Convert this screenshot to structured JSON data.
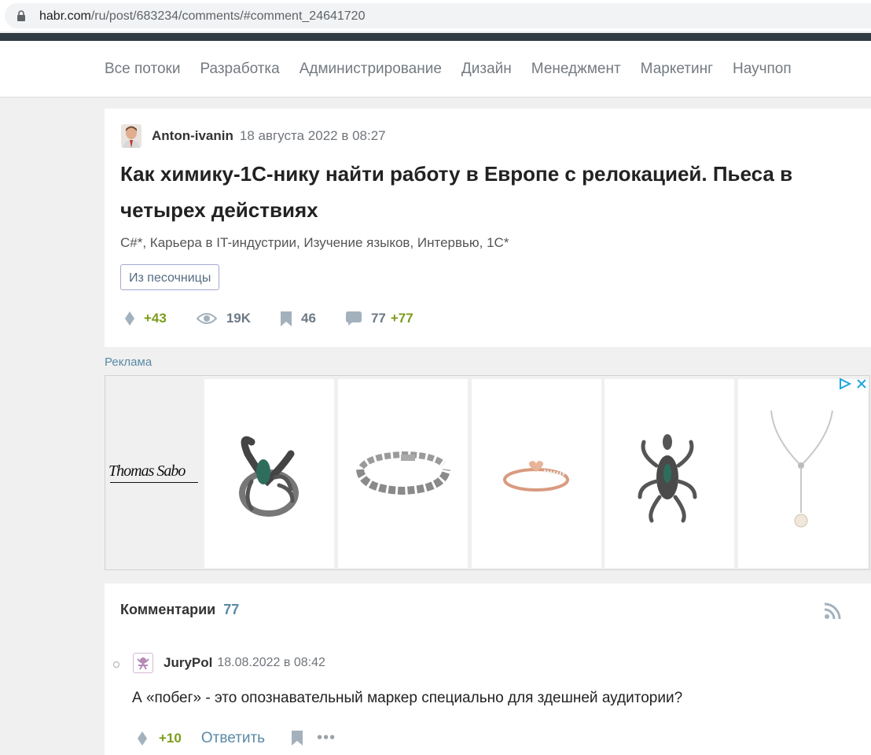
{
  "browser": {
    "url_host": "habr.com",
    "url_path": "/ru/post/683234/comments/#comment_24641720"
  },
  "nav": {
    "items": [
      "Все потоки",
      "Разработка",
      "Администрирование",
      "Дизайн",
      "Менеджмент",
      "Маркетинг",
      "Научпоп"
    ]
  },
  "article": {
    "author": "Anton-ivanin",
    "date": "18 августа 2022 в 08:27",
    "title": "Как химику-1С-нику найти работу в Европе с релокацией. Пьеса в четырех действиях",
    "hubs": "C#*, Карьера в IT-индустрии, Изучение языков, Интервью, 1С*",
    "sandbox_label": "Из песочницы",
    "stats": {
      "rating": "+43",
      "views": "19K",
      "bookmarks": "46",
      "comments": "77",
      "new_comments": "+77"
    }
  },
  "ad": {
    "label": "Реклама",
    "brand": "Thomas Sabo"
  },
  "comments": {
    "heading": "Комментарии",
    "count": "77",
    "items": [
      {
        "author": "JuryPol",
        "date": "18.08.2022 в 08:42",
        "text": "А «побег» - это опознавательный маркер специально для здешней аудитории?",
        "score": "+10",
        "reply_label": "Ответить",
        "more_label": "•••"
      }
    ]
  },
  "colors": {
    "accent_green": "#7b9c1c",
    "link_blue": "#5a8aa6",
    "topbar": "#303b44"
  }
}
